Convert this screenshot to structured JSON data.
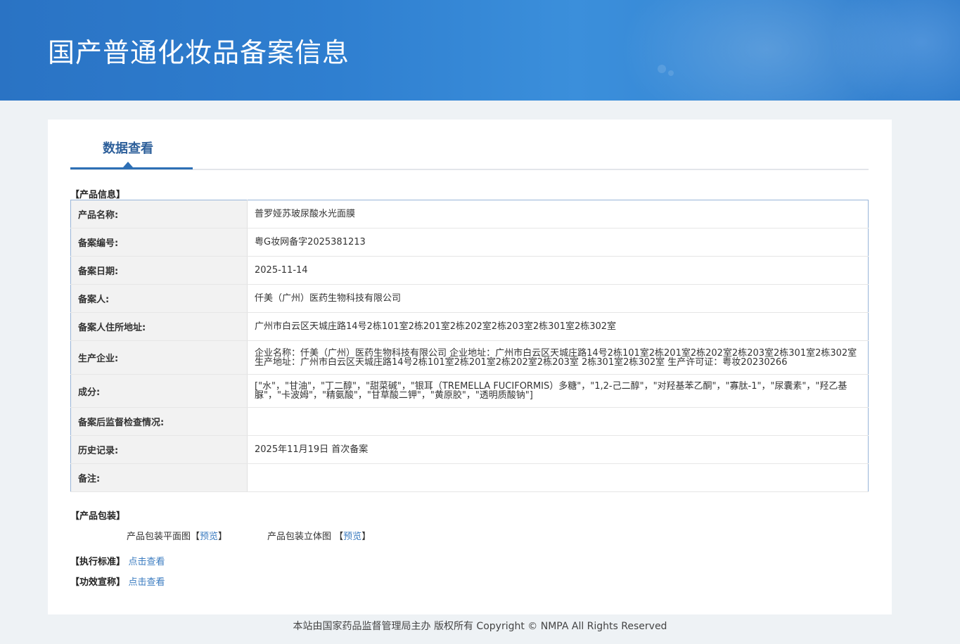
{
  "banner": {
    "title": "国产普通化妆品备案信息"
  },
  "tab": {
    "label": "数据查看"
  },
  "product_info": {
    "heading": "【产品信息】",
    "rows": [
      {
        "label": "产品名称:",
        "value": "普罗娅苏玻尿酸水光面膜"
      },
      {
        "label": "备案编号:",
        "value": "粤G妆网备字2025381213"
      },
      {
        "label": "备案日期:",
        "value": "2025-11-14"
      },
      {
        "label": "备案人:",
        "value": "仟美（广州）医药生物科技有限公司"
      },
      {
        "label": "备案人住所地址:",
        "value": "广州市白云区天城庄路14号2栋101室2栋201室2栋202室2栋203室2栋301室2栋302室"
      },
      {
        "label": "生产企业:",
        "value": "企业名称：仟美（广州）医药生物科技有限公司 企业地址：广州市白云区天城庄路14号2栋101室2栋201室2栋202室2栋203室2栋301室2栋302室 生产地址：广州市白云区天城庄路14号2栋101室2栋201室2栋202室2栋203室 2栋301室2栋302室 生产许可证：粤妆20230266"
      },
      {
        "label": "成分:",
        "value": "[\"水\"，\"甘油\"，\"丁二醇\"，\"甜菜碱\"，\"银耳（TREMELLA FUCIFORMIS）多糖\"，\"1,2-己二醇\"，\"对羟基苯乙酮\"，\"寡肽-1\"，\"尿囊素\"，\"羟乙基脲\"，\"卡波姆\"，\"精氨酸\"，\"甘草酸二钾\"，\"黄原胶\"，\"透明质酸钠\"]"
      },
      {
        "label": "备案后监督检查情况:",
        "value": ""
      },
      {
        "label": "历史记录:",
        "value": "2025年11月19日 首次备案"
      },
      {
        "label": "备注:",
        "value": ""
      }
    ]
  },
  "packaging": {
    "heading": "【产品包装】",
    "flat_label": "产品包装平面图",
    "solid_label": "产品包装立体图",
    "preview_link": "预览",
    "bracket_open": "【",
    "bracket_close": "】"
  },
  "standard": {
    "heading": "【执行标准】",
    "link": "点击查看"
  },
  "efficacy": {
    "heading": "【功效宣称】",
    "link": "点击查看"
  },
  "footer": {
    "text": "本站由国家药品监督管理局主办 版权所有 Copyright © NMPA All Rights Reserved"
  },
  "colors": {
    "banner": "#2f7fd0",
    "tab_accent": "#2d6fb5",
    "link": "#3a7bc0"
  }
}
